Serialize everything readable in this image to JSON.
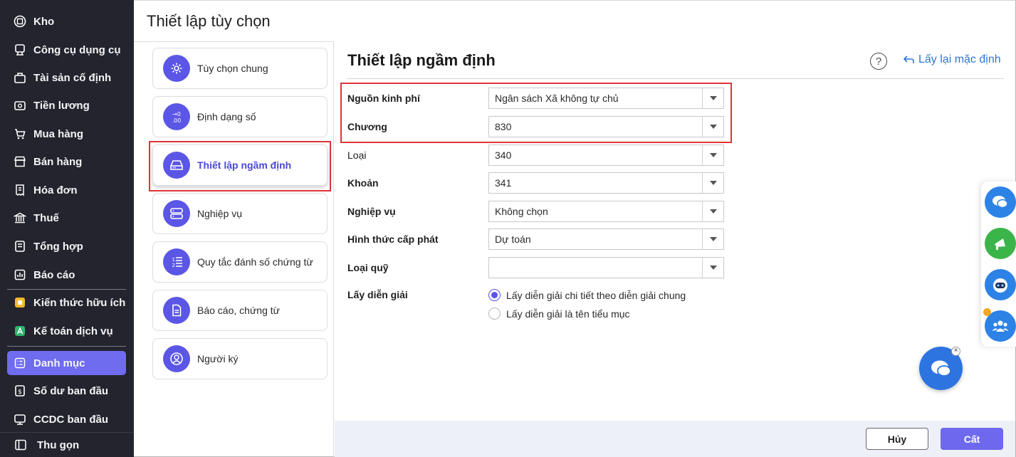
{
  "sidebar": {
    "items": [
      {
        "label": "Kho",
        "icon": "warehouse-icon"
      },
      {
        "label": "Công cụ dụng cụ",
        "icon": "tools-icon"
      },
      {
        "label": "Tài sản cố định",
        "icon": "asset-icon"
      },
      {
        "label": "Tiền lương",
        "icon": "salary-icon"
      },
      {
        "label": "Mua hàng",
        "icon": "cart-icon"
      },
      {
        "label": "Bán hàng",
        "icon": "store-icon"
      },
      {
        "label": "Hóa đơn",
        "icon": "invoice-icon"
      },
      {
        "label": "Thuế",
        "icon": "tax-icon"
      },
      {
        "label": "Tổng hợp",
        "icon": "summary-icon"
      },
      {
        "label": "Báo cáo",
        "icon": "report-icon"
      },
      {
        "label": "Kiến thức hữu ích",
        "icon": "knowledge-icon"
      },
      {
        "label": "Kế toán dịch vụ",
        "icon": "service-accounting-icon"
      },
      {
        "label": "Danh mục",
        "icon": "catalog-icon",
        "active": true
      },
      {
        "label": "Số dư ban đầu",
        "icon": "opening-balance-icon"
      },
      {
        "label": "CCDC ban đầu",
        "icon": "initial-tools-icon"
      }
    ],
    "collapse_label": "Thu gọn"
  },
  "page_title": "Thiết lập tùy chọn",
  "options": [
    {
      "label": "Tùy chọn chung",
      "icon": "gear-icon"
    },
    {
      "label": "Định dạng số",
      "icon": "number-format-icon"
    },
    {
      "label": "Thiết lập ngầm định",
      "icon": "drive-icon",
      "active": true
    },
    {
      "label": "Nghiệp vụ",
      "icon": "server-icon"
    },
    {
      "label": "Quy tắc đánh số chứng từ",
      "icon": "numbered-list-icon"
    },
    {
      "label": "Báo cáo, chứng từ",
      "icon": "document-icon"
    },
    {
      "label": "Người ký",
      "icon": "signer-icon"
    }
  ],
  "section": {
    "title": "Thiết lập ngầm định",
    "help_symbol": "?",
    "reset_label": "Lấy lại mặc định"
  },
  "form": {
    "fields": [
      {
        "label": "Nguồn kinh phí",
        "value": "Ngân sách Xã không tự chủ"
      },
      {
        "label": "Chương",
        "value": "830"
      },
      {
        "label": "Loại",
        "value": "340"
      },
      {
        "label": "Khoản",
        "value": "341"
      },
      {
        "label": "Nghiệp vụ",
        "value": "Không chọn"
      },
      {
        "label": "Hình thức cấp phát",
        "value": "Dự toán"
      },
      {
        "label": "Loại quỹ",
        "value": ""
      }
    ],
    "description": {
      "label": "Lấy diễn giải",
      "options": [
        {
          "label": "Lấy diễn giải chi tiết theo diễn giải chung",
          "checked": true
        },
        {
          "label": "Lấy diễn giải là tên tiểu mục",
          "checked": false
        }
      ]
    }
  },
  "footer": {
    "cancel_label": "Hủy",
    "save_label": "Cất"
  },
  "floating": {
    "close_symbol": "×"
  },
  "colors": {
    "sidebar_bg": "#24242e",
    "accent": "#6f6cf0",
    "icon_circle": "#5b56e6",
    "highlight_box": "#e0343a",
    "link": "#2e76d2"
  }
}
